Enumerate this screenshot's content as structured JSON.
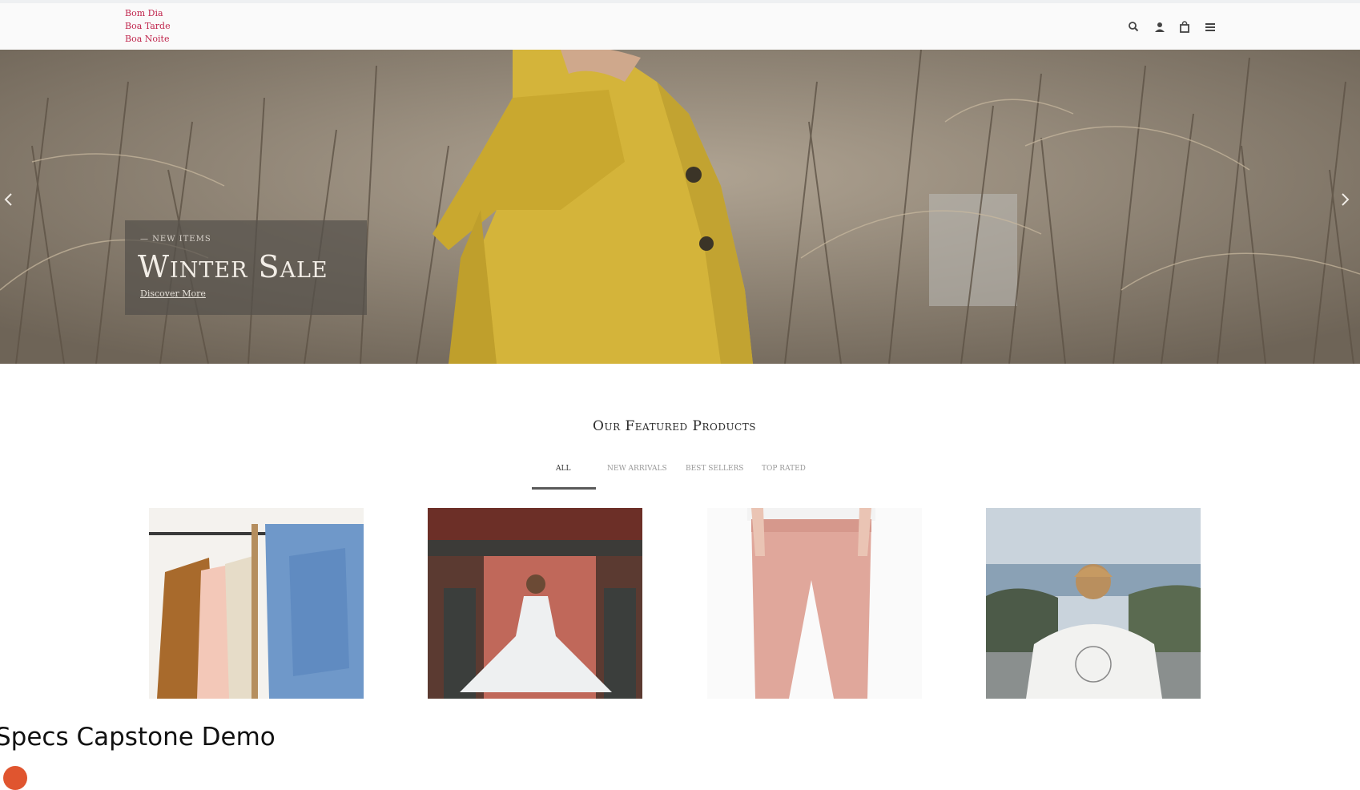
{
  "header": {
    "greetings": [
      "Bom Dia",
      "Boa Tarde",
      "Boa Noite"
    ],
    "icons": [
      "search-icon",
      "account-icon",
      "cart-icon",
      "menu-icon"
    ]
  },
  "hero": {
    "eyebrow": "— NEW ITEMS",
    "title": "Winter Sale",
    "link": "Discover More",
    "arrows": [
      "prev-arrow-icon",
      "next-arrow-icon"
    ]
  },
  "featured": {
    "title": "Our Featured Products",
    "tabs": [
      "All",
      "New Arrivals",
      "Best Sellers",
      "Top Rated"
    ],
    "active_tab": "All",
    "products": [
      {
        "image": "clothes-rack-photo"
      },
      {
        "image": "white-dress-photo"
      },
      {
        "image": "pink-trousers-photo"
      },
      {
        "image": "white-tshirt-back-photo"
      }
    ]
  },
  "footer": {
    "title": "Specs Capstone Demo"
  },
  "colors": {
    "greeting_text": "#c0264d",
    "tab_underline": "#5a5a5a",
    "coat_yellow": "#d4b43a",
    "footer_badge": "#e0552f"
  }
}
